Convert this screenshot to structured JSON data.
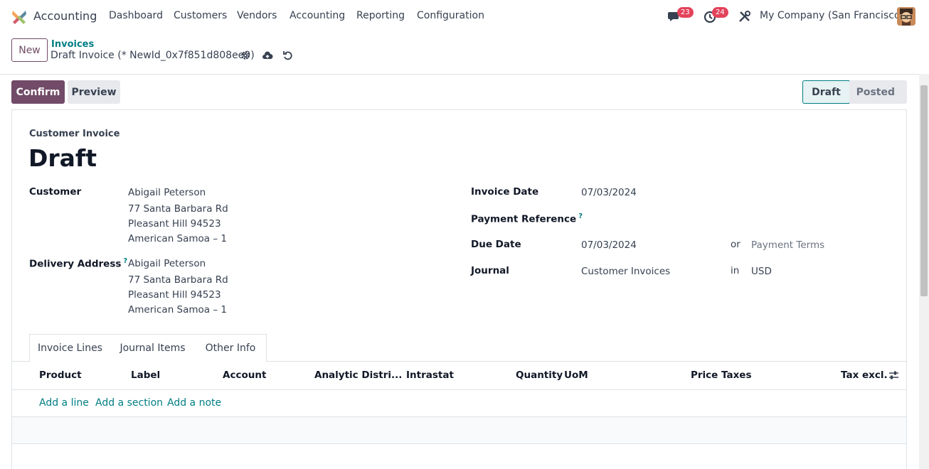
{
  "navbar": {
    "app_name": "Accounting",
    "menus": [
      "Dashboard",
      "Customers",
      "Vendors",
      "Accounting",
      "Reporting",
      "Configuration"
    ],
    "messages_count": "23",
    "activities_count": "24",
    "company": "My Company (San Francisco)"
  },
  "control_panel": {
    "new_label": "New",
    "breadcrumb": "Invoices",
    "record_name": "Draft Invoice (* NewId_0x7f851d808ee0)"
  },
  "actions": {
    "confirm": "Confirm",
    "preview": "Preview"
  },
  "statusbar": {
    "draft": "Draft",
    "posted": "Posted"
  },
  "form": {
    "type_label": "Customer Invoice",
    "title": "Draft",
    "customer_label": "Customer",
    "customer_lines": [
      "Abigail Peterson",
      "77 Santa Barbara Rd",
      "Pleasant Hill 94523",
      "American Samoa – 1"
    ],
    "delivery_label": "Delivery Address",
    "delivery_help": "?",
    "delivery_lines": [
      "Abigail Peterson",
      "77 Santa Barbara Rd",
      "Pleasant Hill 94523",
      "American Samoa – 1"
    ],
    "invoice_date_label": "Invoice Date",
    "invoice_date": "07/03/2024",
    "payment_ref_label": "Payment Reference",
    "payment_ref_help": "?",
    "due_date_label": "Due Date",
    "due_date": "07/03/2024",
    "or_text": "or",
    "payment_terms_placeholder": "Payment Terms",
    "journal_label": "Journal",
    "journal": "Customer Invoices",
    "in_text": "in",
    "currency": "USD"
  },
  "tabs": [
    "Invoice Lines",
    "Journal Items",
    "Other Info"
  ],
  "table": {
    "columns": [
      "Product",
      "Label",
      "Account",
      "Analytic Distri...",
      "Intrastat",
      "Quantity",
      "UoM",
      "Price",
      "Taxes",
      "Tax excl."
    ],
    "add_line": "Add a line",
    "add_section": "Add a section",
    "add_note": "Add a note"
  },
  "colors": {
    "primary": "#714b67",
    "link": "#017e84",
    "badge": "#e3425b"
  }
}
